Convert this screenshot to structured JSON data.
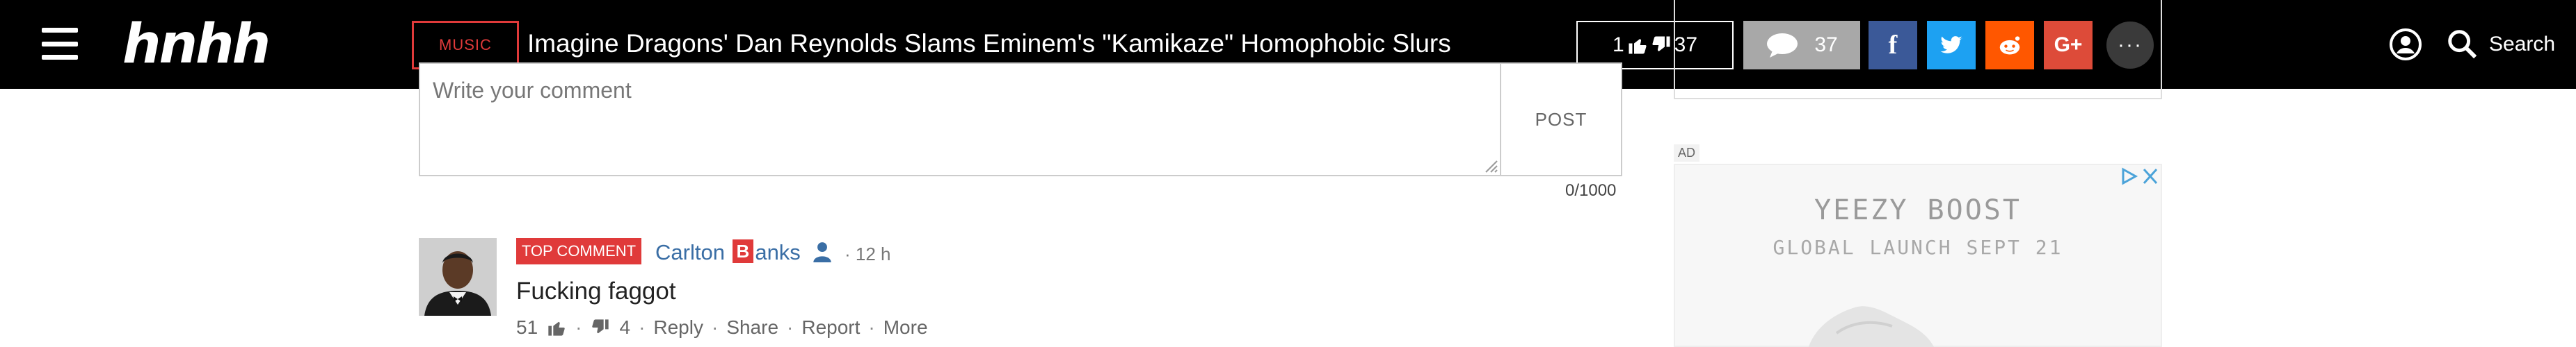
{
  "header": {
    "logo_text": "hnhh",
    "category": "MUSIC",
    "headline": "Imagine Dragons' Dan Reynolds Slams Eminem's \"Kamikaze\" Homophobic Slurs",
    "likes": "1",
    "dislikes": "37",
    "comment_count": "37",
    "search_label": "Search",
    "more_glyph": "···",
    "social": [
      {
        "name": "facebook",
        "glyph": "f",
        "color": "#3b5998"
      },
      {
        "name": "twitter",
        "glyph": "t",
        "color": "#1da1f2"
      },
      {
        "name": "reddit",
        "glyph": "r",
        "color": "#ff5700"
      },
      {
        "name": "google-plus",
        "glyph": "G+",
        "color": "#dd4b39"
      }
    ]
  },
  "comment_form": {
    "placeholder": "Write your comment",
    "post_label": "POST",
    "char_count": "0/1000"
  },
  "comment": {
    "badge": "TOP COMMENT",
    "author_prefix": "Carlton ",
    "author_badge": "B",
    "author_suffix": "anks",
    "time": "· 12 h",
    "text": "Fucking faggot",
    "likes": "51",
    "dislikes": "4",
    "actions": [
      "Reply",
      "Share",
      "Report",
      "More"
    ]
  },
  "sidebar": {
    "ad_label": "AD",
    "ad_title": "YEEZY BOOST",
    "ad_subtitle": "GLOBAL LAUNCH SEPT 21"
  },
  "colors": {
    "accent_red": "#e03a3a",
    "link_blue": "#3a6ea5",
    "topbar": "#000000"
  }
}
